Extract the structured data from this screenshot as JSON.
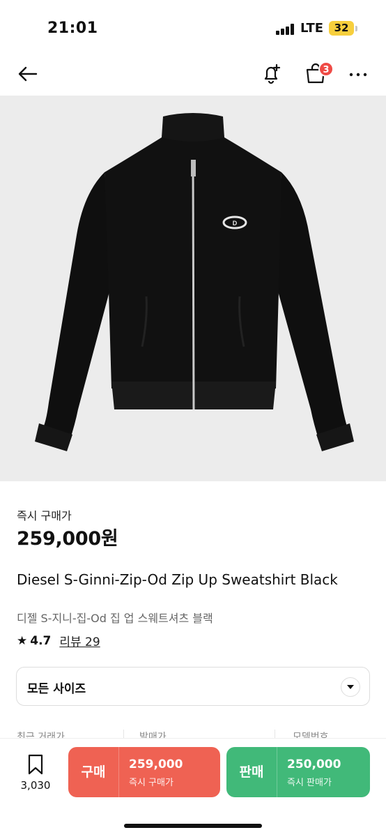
{
  "status_bar": {
    "time": "21:01",
    "network": "LTE",
    "battery": "32"
  },
  "header": {
    "cart_badge": "3",
    "icons": [
      "back-arrow-icon",
      "bell-plus-icon",
      "shopping-bag-icon",
      "more-icon"
    ]
  },
  "product": {
    "image_alt": "black zip-up sweatshirt",
    "price_label": "즉시 구매가",
    "price": "259,000원",
    "name_en": "Diesel S-Ginni-Zip-Od Zip Up Sweatshirt Black",
    "name_ko": "디젤 S-지니-집-Od 집 업 스웨트셔츠 블랙",
    "rating": "4.7",
    "review_label": "리뷰 29"
  },
  "size_select": {
    "value": "모든 사이즈"
  },
  "info_row": {
    "recent_trade": "최근 거래가",
    "release_price": "발매가",
    "model_no": "모델번호"
  },
  "bottom": {
    "bookmark_count": "3,030",
    "buy": {
      "label": "구매",
      "price": "259,000",
      "sub": "즉시 구매가",
      "color": "#ef6253"
    },
    "sell": {
      "label": "판매",
      "price": "250,000",
      "sub": "즉시 판매가",
      "color": "#41b979"
    }
  }
}
